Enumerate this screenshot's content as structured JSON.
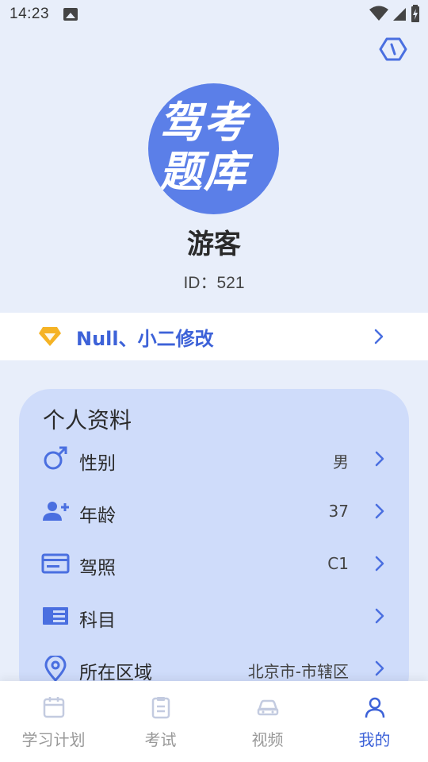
{
  "status_bar": {
    "time": "14:23"
  },
  "profile": {
    "logo_line1": "驾考",
    "logo_line2": "题库",
    "username": "游客",
    "id_text": "ID：521"
  },
  "vip": {
    "label": "Null、小二修改"
  },
  "personal_info": {
    "title": "个人资料",
    "rows": [
      {
        "label": "性别",
        "value": "男",
        "icon": "male-icon"
      },
      {
        "label": "年龄",
        "value": "37",
        "icon": "add-person-icon"
      },
      {
        "label": "驾照",
        "value": "C1",
        "icon": "license-card-icon"
      },
      {
        "label": "科目",
        "value": "",
        "icon": "book-icon"
      },
      {
        "label": "所在区域",
        "value": "北京市-市辖区",
        "icon": "location-pin-icon"
      }
    ]
  },
  "bottom_nav": {
    "items": [
      {
        "label": "学习计划",
        "icon": "calendar-icon"
      },
      {
        "label": "考试",
        "icon": "clipboard-icon"
      },
      {
        "label": "视频",
        "icon": "car-icon"
      },
      {
        "label": "我的",
        "icon": "user-icon"
      }
    ],
    "active_index": 3
  },
  "colors": {
    "accent": "#3d62d8",
    "card_bg": "#cfdcfa",
    "page_bg": "#e8eefa",
    "vip_gold": "#f5b325"
  }
}
